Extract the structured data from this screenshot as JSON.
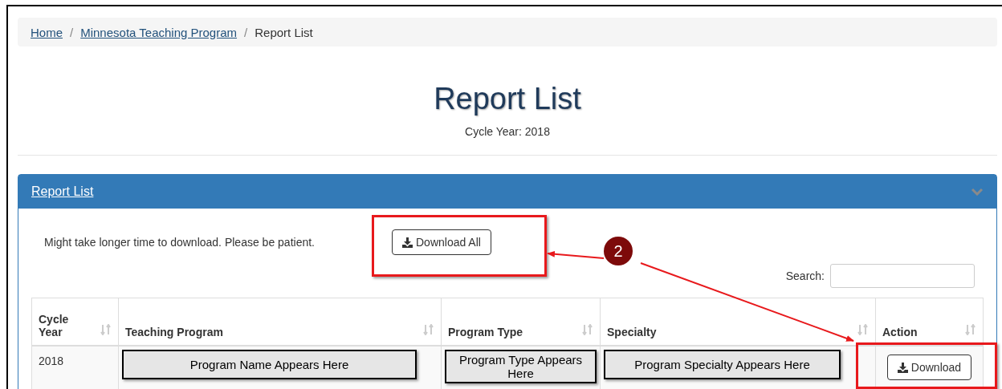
{
  "breadcrumb": [
    {
      "label": "Home",
      "link": true
    },
    {
      "separator": "/",
      "label": "Minnesota Teaching Program",
      "link": true
    },
    {
      "separator": "/",
      "label": "Report List",
      "link": false
    }
  ],
  "page": {
    "title": "Report List",
    "subtitle": "Cycle Year: 2018"
  },
  "panel": {
    "title": "Report List",
    "expanded": true,
    "note": "Might take longer time to download. Please be patient.",
    "download_all": "Download All",
    "search_label": "Search:"
  },
  "table": {
    "columns": [
      {
        "label": "Cycle Year",
        "sortable": true
      },
      {
        "label": "Teaching Program",
        "sortable": true
      },
      {
        "label": "Program Type",
        "sortable": true
      },
      {
        "label": "Specialty",
        "sortable": true
      },
      {
        "label": "Action",
        "sortable": true
      }
    ],
    "rows": [
      {
        "cells": [
          {
            "kind": "text",
            "text": "2018"
          },
          {
            "kind": "placeholder",
            "text": "Program Name Appears Here"
          },
          {
            "kind": "placeholder",
            "text": "Program Type Appears Here"
          },
          {
            "kind": "placeholder",
            "text": "Program Specialty Appears Here"
          },
          {
            "kind": "button",
            "text": "Download"
          }
        ]
      }
    ]
  },
  "annotation": {
    "step": "2"
  }
}
